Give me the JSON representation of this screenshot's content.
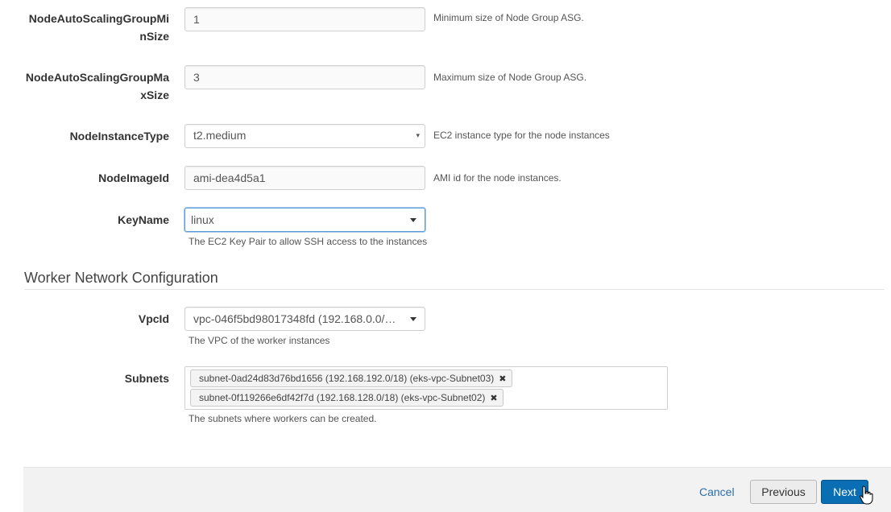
{
  "fields": [
    {
      "label_line1": "NodeAutoScalingGroupMi",
      "label_line2": "nSize",
      "value": "1",
      "description": "Minimum size of Node Group ASG."
    },
    {
      "label_line1": "NodeAutoScalingGroupMa",
      "label_line2": "xSize",
      "value": "3",
      "description": "Maximum size of Node Group ASG."
    },
    {
      "label": "NodeInstanceType",
      "value": "t2.medium",
      "description": "EC2 instance type for the node instances"
    },
    {
      "label": "NodeImageId",
      "value": "ami-dea4d5a1",
      "description": "AMI id for the node instances."
    },
    {
      "label": "KeyName",
      "value": "linux",
      "description": "The EC2 Key Pair to allow SSH access to the instances"
    }
  ],
  "section": {
    "title": "Worker Network Configuration"
  },
  "network": {
    "vpc": {
      "label": "VpcId",
      "value": "vpc-046f5bd98017348fd (192.168.0.0/1…",
      "description": "The VPC of the worker instances"
    },
    "subnets": {
      "label": "Subnets",
      "tags": [
        "subnet-0ad24d83d76bd1656 (192.168.192.0/18) (eks-vpc-Subnet03)",
        "subnet-0f119266e6df42f7d (192.168.128.0/18) (eks-vpc-Subnet02)"
      ],
      "remove_glyph": "✖",
      "description": "The subnets where workers can be created."
    }
  },
  "footer": {
    "cancel": "Cancel",
    "previous": "Previous",
    "next": "Next"
  },
  "icons": {
    "dropdown_caret": "▾"
  },
  "colors": {
    "primary": "#0a6eb4",
    "link": "#2b6ea8",
    "focus": "#5b9dd9"
  }
}
